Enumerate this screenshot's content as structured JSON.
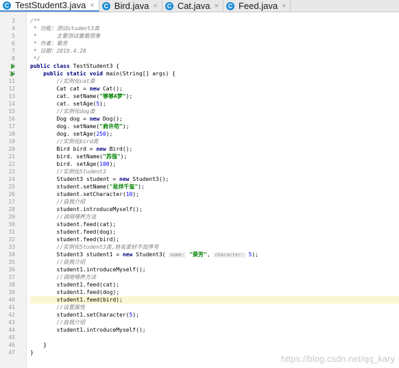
{
  "tabs": [
    {
      "label": "TestStudent3.java",
      "icon": "C",
      "active": true
    },
    {
      "label": "Bird.java",
      "icon": "C",
      "active": false
    },
    {
      "label": "Cat.java",
      "icon": "C",
      "active": false
    },
    {
      "label": "Feed.java",
      "icon": "C",
      "active": false
    }
  ],
  "close_glyph": "×",
  "watermark": "https://blog.csdn.net/qq_kary",
  "editor": {
    "highlight_line": 40,
    "run_lines": [
      9,
      10
    ],
    "lines": [
      {
        "n": 3,
        "segs": [
          {
            "c": "cm",
            "t": "/**"
          }
        ]
      },
      {
        "n": 4,
        "segs": [
          {
            "c": "cm",
            "t": " * 功能：测试student3类"
          }
        ]
      },
      {
        "n": 5,
        "segs": [
          {
            "c": "cm",
            "t": " *      主要测试重载现象"
          }
        ]
      },
      {
        "n": 6,
        "segs": [
          {
            "c": "cm",
            "t": " * 作者：葵芳"
          }
        ]
      },
      {
        "n": 7,
        "segs": [
          {
            "c": "cm",
            "t": " * 日期：2019.4.28"
          }
        ]
      },
      {
        "n": 8,
        "segs": [
          {
            "c": "cm",
            "t": " */"
          }
        ]
      },
      {
        "n": 9,
        "segs": [
          {
            "c": "kw",
            "t": "public class "
          },
          {
            "c": "",
            "t": "TestStudent3 {"
          }
        ]
      },
      {
        "n": 10,
        "segs": [
          {
            "c": "",
            "t": "    "
          },
          {
            "c": "kw",
            "t": "public static void "
          },
          {
            "c": "",
            "t": "main(String[] args) {"
          }
        ]
      },
      {
        "n": 11,
        "segs": [
          {
            "c": "cm",
            "t": "        //实例化cat类"
          }
        ]
      },
      {
        "n": 12,
        "segs": [
          {
            "c": "",
            "t": "        Cat cat = "
          },
          {
            "c": "kw",
            "t": "new "
          },
          {
            "c": "",
            "t": "Cat();"
          }
        ]
      },
      {
        "n": 13,
        "segs": [
          {
            "c": "",
            "t": "        cat. setName("
          },
          {
            "c": "str",
            "t": "\"够够A梦\""
          },
          {
            "c": "",
            "t": ");"
          }
        ]
      },
      {
        "n": 14,
        "segs": [
          {
            "c": "",
            "t": "        cat. setAge("
          },
          {
            "c": "num",
            "t": "5"
          },
          {
            "c": "",
            "t": ");"
          }
        ]
      },
      {
        "n": 15,
        "segs": [
          {
            "c": "cm",
            "t": "        //实例化dog类"
          }
        ]
      },
      {
        "n": 16,
        "segs": [
          {
            "c": "",
            "t": "        Dog dog = "
          },
          {
            "c": "kw",
            "t": "new "
          },
          {
            "c": "",
            "t": "Dog();"
          }
        ]
      },
      {
        "n": 17,
        "segs": [
          {
            "c": "",
            "t": "        dog. setName("
          },
          {
            "c": "str",
            "t": "\"肩许苟\""
          },
          {
            "c": "",
            "t": ");"
          }
        ]
      },
      {
        "n": 18,
        "segs": [
          {
            "c": "",
            "t": "        dog. setAge("
          },
          {
            "c": "num",
            "t": "250"
          },
          {
            "c": "",
            "t": ");"
          }
        ]
      },
      {
        "n": 19,
        "segs": [
          {
            "c": "cm",
            "t": "        //实例化bird类"
          }
        ]
      },
      {
        "n": 20,
        "segs": [
          {
            "c": "",
            "t": "        Bird bird = "
          },
          {
            "c": "kw",
            "t": "new "
          },
          {
            "c": "",
            "t": "Bird();"
          }
        ]
      },
      {
        "n": 21,
        "segs": [
          {
            "c": "",
            "t": "        bird. setName("
          },
          {
            "c": "str",
            "t": "\"苏强\""
          },
          {
            "c": "",
            "t": ");"
          }
        ]
      },
      {
        "n": 22,
        "segs": [
          {
            "c": "",
            "t": "        bird. setAge("
          },
          {
            "c": "num",
            "t": "100"
          },
          {
            "c": "",
            "t": ");"
          }
        ]
      },
      {
        "n": 23,
        "segs": [
          {
            "c": "cm",
            "t": "        //实例化Student3"
          }
        ]
      },
      {
        "n": 24,
        "segs": [
          {
            "c": "",
            "t": "        Student3 student = "
          },
          {
            "c": "kw",
            "t": "new "
          },
          {
            "c": "",
            "t": "Student3();"
          }
        ]
      },
      {
        "n": 25,
        "segs": [
          {
            "c": "",
            "t": "        student.setName("
          },
          {
            "c": "str",
            "t": "\"易烊千玺\""
          },
          {
            "c": "",
            "t": ");"
          }
        ]
      },
      {
        "n": 26,
        "segs": [
          {
            "c": "",
            "t": "        student.setCharacter("
          },
          {
            "c": "num",
            "t": "10"
          },
          {
            "c": "",
            "t": ");"
          }
        ]
      },
      {
        "n": 27,
        "segs": [
          {
            "c": "cm",
            "t": "        //自我介绍"
          }
        ]
      },
      {
        "n": 28,
        "segs": [
          {
            "c": "",
            "t": "        student.introduceMyself();"
          }
        ]
      },
      {
        "n": 29,
        "segs": [
          {
            "c": "cm",
            "t": "        //调用喂养方法"
          }
        ]
      },
      {
        "n": 30,
        "segs": [
          {
            "c": "",
            "t": "        student.feed(cat);"
          }
        ]
      },
      {
        "n": 31,
        "segs": [
          {
            "c": "",
            "t": "        student.feed(dog);"
          }
        ]
      },
      {
        "n": 32,
        "segs": [
          {
            "c": "",
            "t": "        student.feed(bird);"
          }
        ]
      },
      {
        "n": 33,
        "segs": [
          {
            "c": "cm",
            "t": "        //实例化Student3类,姓名爱好不加序号"
          }
        ]
      },
      {
        "n": 34,
        "segs": [
          {
            "c": "",
            "t": "        Student3 student1 = "
          },
          {
            "c": "kw",
            "t": "new "
          },
          {
            "c": "",
            "t": "Student3( "
          },
          {
            "c": "hint",
            "t": "name:"
          },
          {
            "c": "",
            "t": " "
          },
          {
            "c": "str",
            "t": "\"葵芳\""
          },
          {
            "c": "",
            "t": ", "
          },
          {
            "c": "hint",
            "t": "character:"
          },
          {
            "c": "",
            "t": " "
          },
          {
            "c": "num",
            "t": "5"
          },
          {
            "c": "",
            "t": ");"
          }
        ]
      },
      {
        "n": 35,
        "segs": [
          {
            "c": "cm",
            "t": "        //自我介绍"
          }
        ]
      },
      {
        "n": 36,
        "segs": [
          {
            "c": "",
            "t": "        student1.introduceMyself();"
          }
        ]
      },
      {
        "n": 37,
        "segs": [
          {
            "c": "cm",
            "t": "        //调用喂养方法"
          }
        ]
      },
      {
        "n": 38,
        "segs": [
          {
            "c": "",
            "t": "        student1.feed(cat);"
          }
        ]
      },
      {
        "n": 39,
        "segs": [
          {
            "c": "",
            "t": "        student1.feed(dog);"
          }
        ]
      },
      {
        "n": 40,
        "segs": [
          {
            "c": "",
            "t": "        student1.feed(bird);"
          }
        ]
      },
      {
        "n": 41,
        "segs": [
          {
            "c": "cm",
            "t": "        //设置属性"
          }
        ]
      },
      {
        "n": 42,
        "segs": [
          {
            "c": "",
            "t": "        student1.setCharacter("
          },
          {
            "c": "num",
            "t": "5"
          },
          {
            "c": "",
            "t": ");"
          }
        ]
      },
      {
        "n": 43,
        "segs": [
          {
            "c": "cm",
            "t": "        //自我介绍"
          }
        ]
      },
      {
        "n": 44,
        "segs": [
          {
            "c": "",
            "t": "        student1.introduceMyself();"
          }
        ]
      },
      {
        "n": 45,
        "segs": []
      },
      {
        "n": 46,
        "segs": [
          {
            "c": "",
            "t": "    }"
          }
        ]
      },
      {
        "n": 47,
        "segs": [
          {
            "c": "",
            "t": "}"
          }
        ]
      }
    ]
  }
}
